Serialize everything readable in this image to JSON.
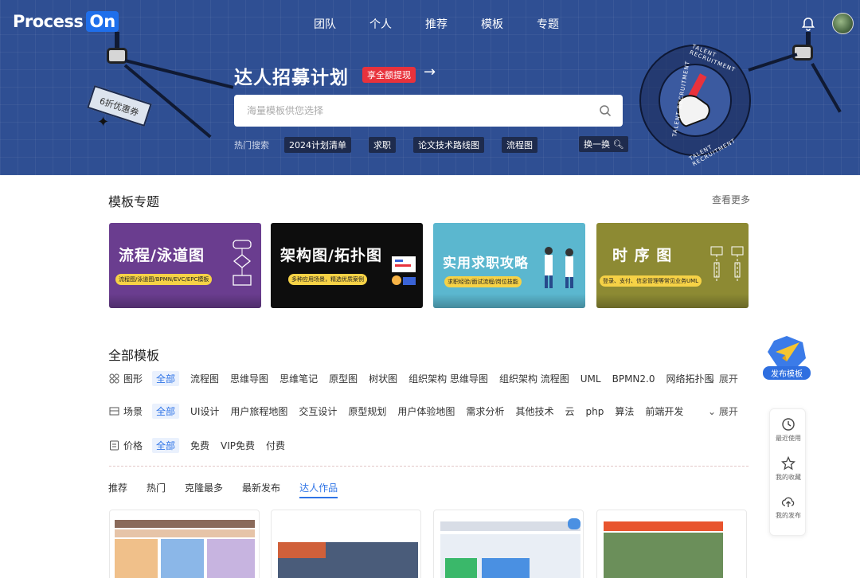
{
  "brand": {
    "name": "Process",
    "suffix": "On"
  },
  "nav": [
    "团队",
    "个人",
    "推荐",
    "模板",
    "专题"
  ],
  "hero": {
    "title": "达人招募计划",
    "badge": "享全额提现",
    "coupon": "6折优惠券",
    "search_placeholder": "海量模板供您选择",
    "hot_label": "热门搜索",
    "hot_tags": [
      "2024计划清单",
      "求职",
      "论文技术路线图",
      "流程图"
    ],
    "refresh": "换一换",
    "stamp_text": "TALENT RECRUITMENT"
  },
  "topics": {
    "title": "模板专题",
    "more": "查看更多",
    "cards": [
      {
        "title": "流程/泳道图",
        "subtitle": "流程图/泳道图/BPMN/EVC/EPC模板",
        "bg": "#6a3d8f"
      },
      {
        "title": "架构图/拓扑图",
        "subtitle": "多种应用场景，精选优质案例",
        "bg": "#0d0d0d"
      },
      {
        "title": "实用求职攻略",
        "subtitle": "求职经验/面试流程/岗位技能",
        "bg": "#5bb7cf"
      },
      {
        "title": "时 序 图",
        "subtitle": "登录、支付、信息管理等常见业务UML",
        "bg": "#8d8a33"
      }
    ]
  },
  "all_templates": {
    "title": "全部模板",
    "expand": "展开",
    "filters": [
      {
        "label": "图形",
        "options": [
          "全部",
          "流程图",
          "思维导图",
          "思维笔记",
          "原型图",
          "树状图",
          "组织架构 思维导图",
          "组织架构 流程图",
          "UML",
          "BPMN2.0",
          "网络拓扑图"
        ]
      },
      {
        "label": "场景",
        "options": [
          "全部",
          "UI设计",
          "用户旅程地图",
          "交互设计",
          "原型规划",
          "用户体验地图",
          "需求分析",
          "其他技术",
          "云",
          "php",
          "算法",
          "前端开发"
        ]
      },
      {
        "label": "价格",
        "options": [
          "全部",
          "免费",
          "VIP免费",
          "付费"
        ]
      }
    ],
    "tabs": [
      "推荐",
      "热门",
      "克隆最多",
      "最新发布",
      "达人作品"
    ],
    "active_tab": "达人作品"
  },
  "float": {
    "publish": "发布模板",
    "recent": "最近使用",
    "favorites": "我的收藏",
    "published": "我的发布"
  },
  "colors": {
    "hero_bg": "#2f4f93",
    "accent": "#2f74e6",
    "badge_red": "#e8323c",
    "tag_bg": "#1e2b4d"
  }
}
